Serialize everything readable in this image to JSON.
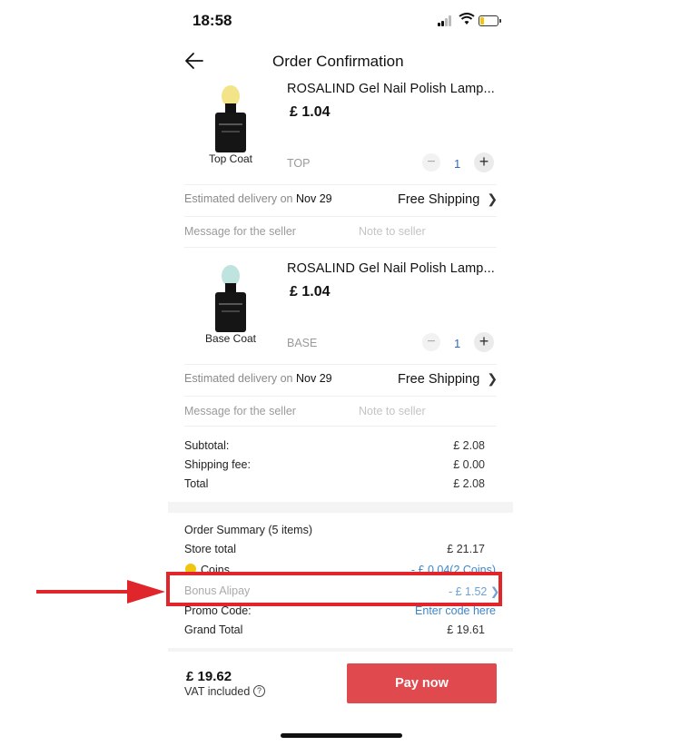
{
  "status_bar": {
    "time": "18:58"
  },
  "header": {
    "title": "Order Confirmation"
  },
  "products": [
    {
      "title": "ROSALIND Gel Nail Polish Lamp...",
      "price": "£ 1.04",
      "image_caption": "Top Coat",
      "variant": "TOP",
      "quantity": "1",
      "delivery_label": "Estimated delivery on",
      "delivery_date": "Nov 29",
      "shipping": "Free Shipping",
      "message_label": "Message for the seller",
      "message_placeholder": "Note to seller",
      "cap_color": "#f3e48a"
    },
    {
      "title": "ROSALIND Gel Nail Polish Lamp...",
      "price": "£ 1.04",
      "image_caption": "Base Coat",
      "variant": "BASE",
      "quantity": "1",
      "delivery_label": "Estimated delivery on",
      "delivery_date": "Nov 29",
      "shipping": "Free Shipping",
      "message_label": "Message for the seller",
      "message_placeholder": "Note to seller",
      "cap_color": "#bfe3df"
    }
  ],
  "store_summary": {
    "subtotal_label": "Subtotal:",
    "subtotal": "£ 2.08",
    "shipping_label": "Shipping fee:",
    "shipping": "£ 0.00",
    "total_label": "Total",
    "total": "£ 2.08"
  },
  "order_summary": {
    "title": "Order Summary (5 items)",
    "store_total_label": "Store total",
    "store_total": "£ 21.17",
    "coins_label": "Coins",
    "coins": "- £ 0.04(2 Coins)",
    "bonus_label": "Bonus Alipay",
    "bonus": "- £ 1.52",
    "promo_label": "Promo Code:",
    "promo": "Enter code here",
    "grand_total_label": "Grand Total",
    "grand_total": "£ 19.61"
  },
  "footer": {
    "total": "£ 19.62",
    "vat": "VAT included",
    "pay_label": "Pay now"
  },
  "colors": {
    "accent": "#e04a4e",
    "link": "#3f86c8",
    "annotation": "#e0262b"
  }
}
